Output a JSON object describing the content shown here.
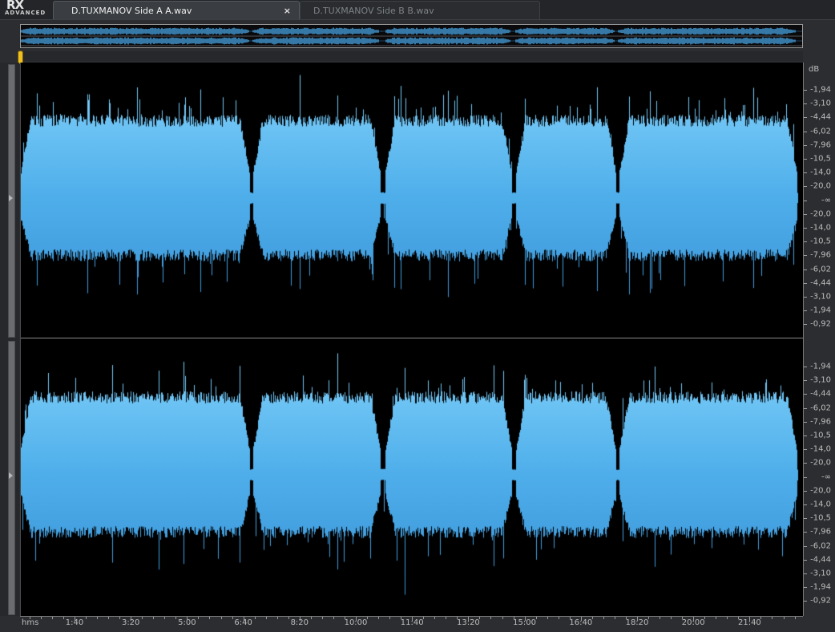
{
  "app": {
    "logo_text": "RX",
    "logo_sub": "ADVANCED"
  },
  "tabs": [
    {
      "label": "D.TUXMANOV Side A A.wav",
      "active": true,
      "close_icon": "×"
    },
    {
      "label": "D.TUXMANOV Side B B.wav",
      "active": false
    }
  ],
  "db_scale": {
    "unit": "dB",
    "labels": [
      "-1,94",
      "-3,10",
      "-4,44",
      "-6,02",
      "-7,96",
      "-10,5",
      "-14,0",
      "-20,0",
      "-∞",
      "-20,0",
      "-14,0",
      "-10,5",
      "-7,96",
      "-6,02",
      "-4,44",
      "-3,10",
      "-1,94",
      "-0,92"
    ]
  },
  "timeline": {
    "unit": "hms",
    "labels": [
      "1:40",
      "3:20",
      "5:00",
      "6:40",
      "8:20",
      "10:00",
      "11:40",
      "13:20",
      "15:00",
      "16:40",
      "18:20",
      "20:00",
      "21:40"
    ]
  },
  "colors": {
    "waveform": "#4aa8e8",
    "waveform_top": "#6cc4f4",
    "background": "#000000",
    "playhead": "#f0c020"
  },
  "icons": {
    "close": "close-icon",
    "channel_arrow": "chevron-right-icon",
    "playhead": "playhead-marker-icon"
  }
}
